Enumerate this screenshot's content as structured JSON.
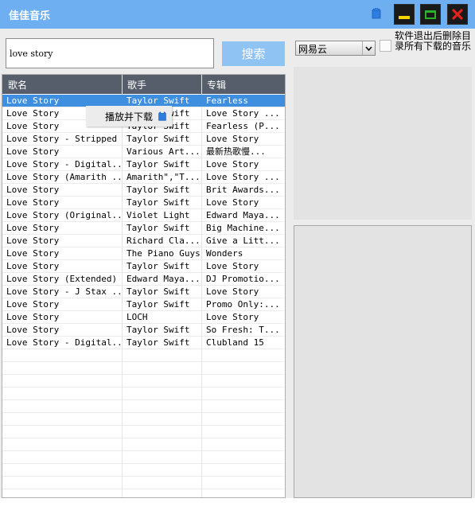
{
  "app": {
    "title": "佳佳音乐"
  },
  "window_controls": {
    "skin": "shirt-icon",
    "minimize": "minimize-icon",
    "maximize": "maximize-icon",
    "close": "close-icon"
  },
  "search": {
    "query": "love story",
    "button_label": "搜索"
  },
  "source": {
    "selected": "网易云"
  },
  "option": {
    "label": "软件退出后删除目录所有下载的音乐",
    "checked": false
  },
  "table": {
    "headers": [
      "歌名",
      "歌手",
      "专辑"
    ],
    "selected_index": 0,
    "rows": [
      [
        "Love Story",
        "Taylor Swift",
        "Fearless"
      ],
      [
        "Love Story",
        "Taylor Swift",
        "Love Story ..."
      ],
      [
        "Love Story",
        "Taylor Swift",
        "Fearless (P..."
      ],
      [
        "Love Story - Stripped",
        "Taylor Swift",
        "Love Story"
      ],
      [
        "Love Story",
        "Various Art...",
        "最新热歌慢..."
      ],
      [
        "Love Story - Digital...",
        "Taylor Swift",
        "Love Story"
      ],
      [
        "Love Story (Amarith ...",
        "Amarith\",\"T...",
        "Love Story ..."
      ],
      [
        "Love Story",
        "Taylor Swift",
        "Brit Awards..."
      ],
      [
        "Love Story",
        "Taylor Swift",
        "Love Story"
      ],
      [
        "Love Story (Original...",
        "Violet Light",
        "Edward Maya..."
      ],
      [
        "Love Story",
        "Taylor Swift",
        "Big Machine..."
      ],
      [
        "Love Story",
        "Richard Cla...",
        "Give a Litt..."
      ],
      [
        "Love Story",
        "The Piano Guys",
        "Wonders"
      ],
      [
        "Love Story",
        "Taylor Swift",
        "Love Story"
      ],
      [
        "Love Story  (Extended)",
        "Edward Maya...",
        "DJ Promotio..."
      ],
      [
        "Love Story - J Stax ...",
        "Taylor Swift",
        "Love Story"
      ],
      [
        "Love Story",
        "Taylor Swift",
        "Promo Only:..."
      ],
      [
        "Love Story",
        "LOCH",
        "Love Story"
      ],
      [
        "Love Story",
        "Taylor Swift",
        "So Fresh: T..."
      ],
      [
        "Love Story - Digital...",
        "Taylor Swift",
        "Clubland 15"
      ]
    ]
  },
  "context_menu": {
    "item": "播放并下载"
  },
  "colors": {
    "titlebar": "#6eaff1",
    "search_button": "#8fc3f3",
    "header": "#555e6a",
    "selected_row": "#3f8fe0",
    "close": "#e0231b",
    "minimize": "#f2d600",
    "maximize": "#29b429"
  }
}
